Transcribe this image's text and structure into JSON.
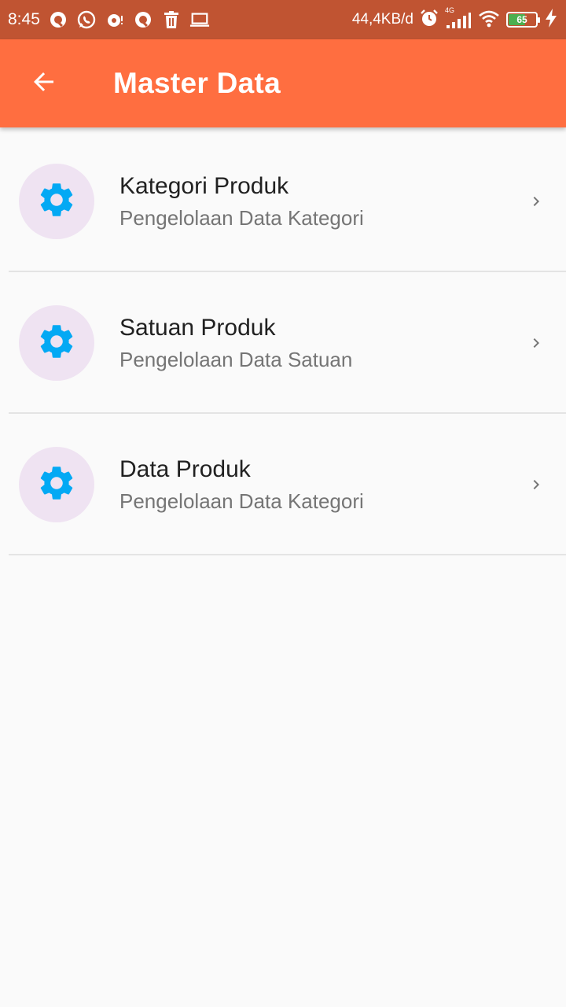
{
  "status_bar": {
    "time": "8:45",
    "net_speed": "44,4KB/d",
    "network_type": "4G",
    "battery_level": "65",
    "battery_percent": 65,
    "color": "#c05432"
  },
  "app_bar": {
    "title": "Master Data",
    "color": "#ff6e40",
    "back_icon": "arrow-back-icon"
  },
  "items": [
    {
      "title": "Kategori Produk",
      "subtitle": "Pengelolaan Data Kategori",
      "icon": "gear-icon"
    },
    {
      "title": "Satuan Produk",
      "subtitle": "Pengelolaan Data Satuan",
      "icon": "gear-icon"
    },
    {
      "title": "Data Produk",
      "subtitle": "Pengelolaan Data Kategori",
      "icon": "gear-icon"
    }
  ],
  "colors": {
    "icon": "#03a9f4",
    "avatar_bg": "#efe3f2",
    "chevron": "#757575",
    "battery_fill": "#4caf50"
  }
}
